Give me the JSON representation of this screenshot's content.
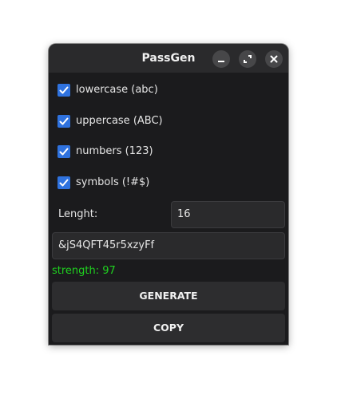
{
  "window": {
    "title": "PassGen"
  },
  "titlebar_buttons": {
    "minimize_icon": "minimize-icon",
    "maximize_icon": "maximize-icon",
    "close_icon": "close-icon"
  },
  "options": [
    {
      "label": "lowercase (abc)",
      "checked": true
    },
    {
      "label": "uppercase (ABC)",
      "checked": true
    },
    {
      "label": "numbers (123)",
      "checked": true
    },
    {
      "label": "symbols (!#$)",
      "checked": true
    }
  ],
  "length": {
    "label": "Lenght:",
    "value": "16"
  },
  "password": {
    "value": "&jS4QFT45r5xzyFf"
  },
  "strength": {
    "text": "strength: 97"
  },
  "actions": {
    "generate_label": "GENERATE",
    "copy_label": "COPY"
  },
  "colors": {
    "accent": "#2f72de",
    "strength": "#1fd21f",
    "background": "#1b1b1d"
  }
}
